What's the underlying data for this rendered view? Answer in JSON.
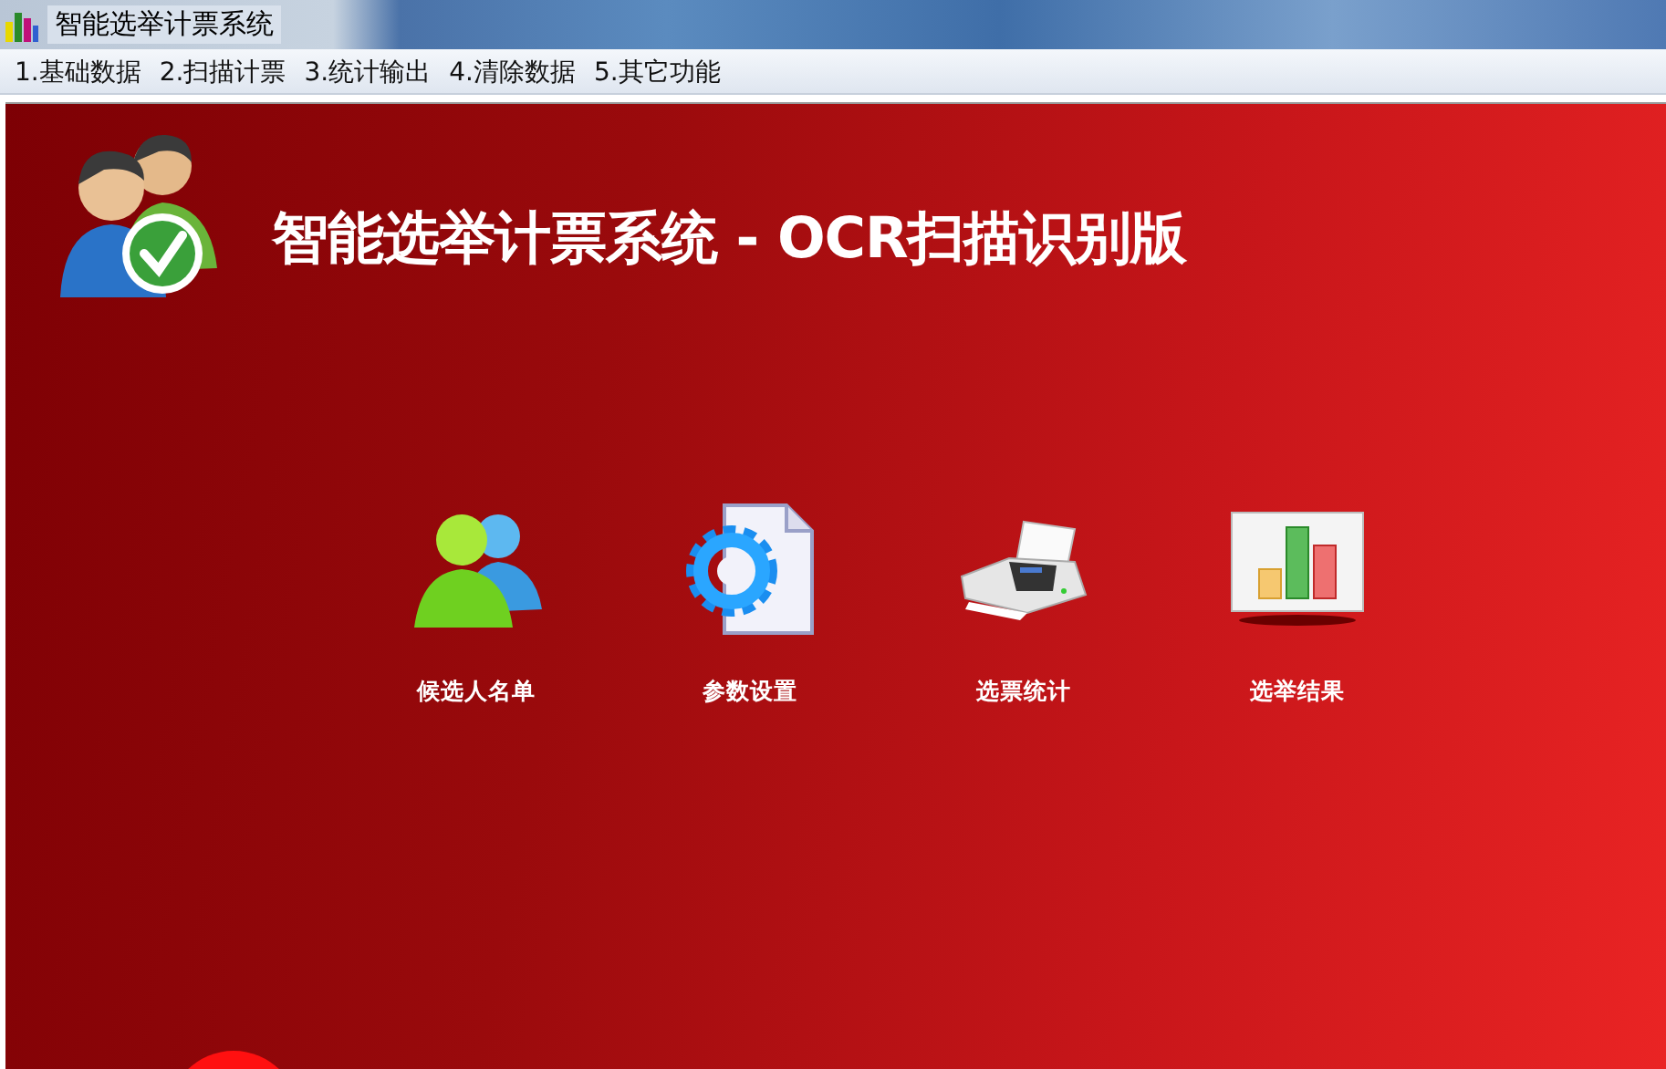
{
  "window": {
    "title": "智能选举计票系统"
  },
  "menu": [
    {
      "label": "1.基础数据"
    },
    {
      "label": "2.扫描计票"
    },
    {
      "label": "3.统计输出"
    },
    {
      "label": "4.清除数据"
    },
    {
      "label": "5.其它功能"
    }
  ],
  "header": {
    "title": "智能选举计票系统 - OCR扫描识别版"
  },
  "launchers": [
    {
      "label": "候选人名单"
    },
    {
      "label": "参数设置"
    },
    {
      "label": "选票统计"
    },
    {
      "label": "选举结果"
    }
  ]
}
